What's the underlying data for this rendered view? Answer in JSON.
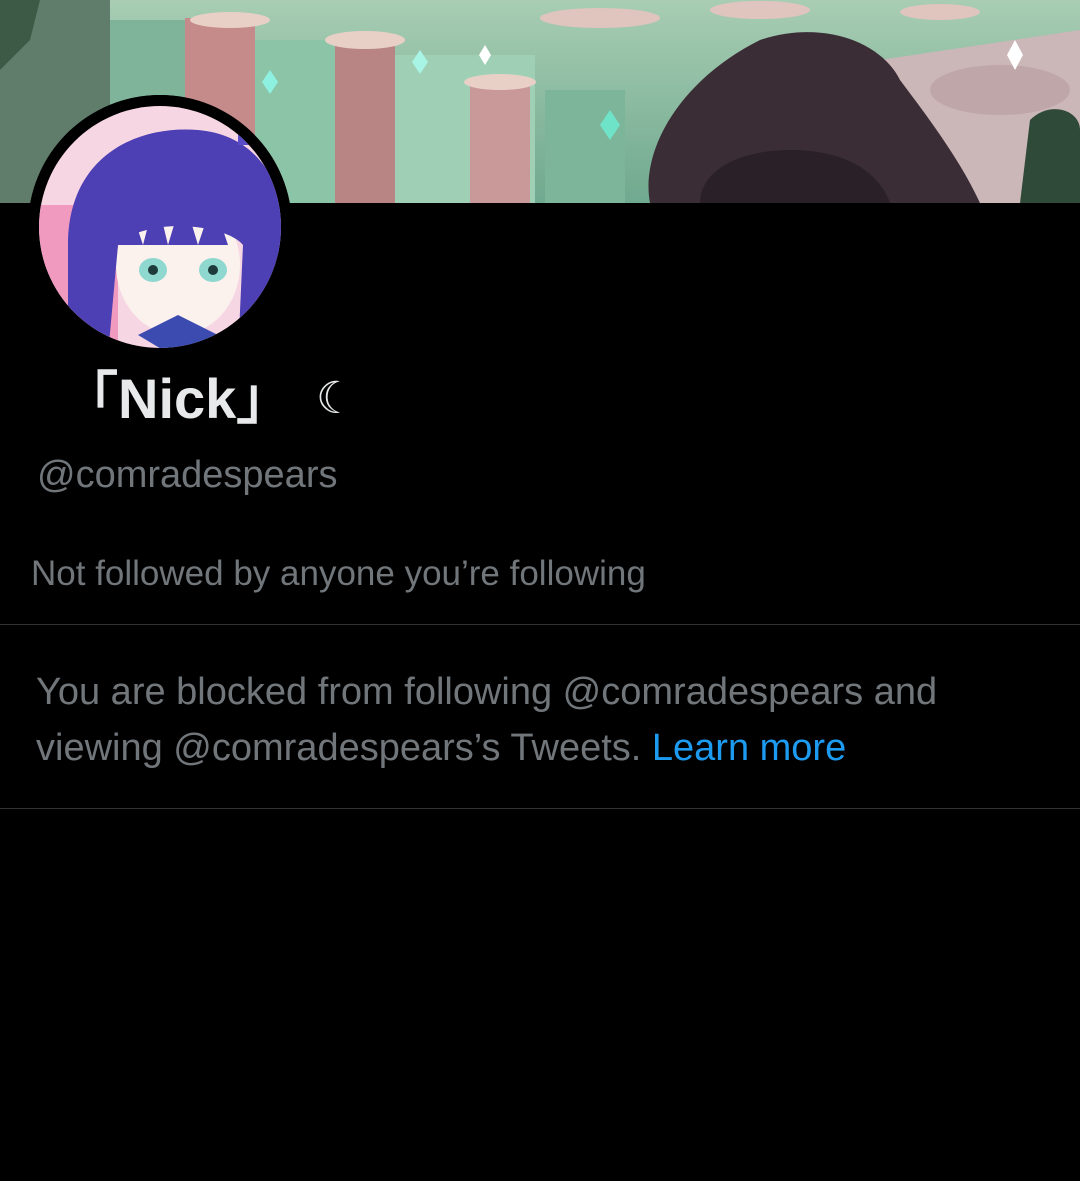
{
  "profile": {
    "display_name": "「Nick」",
    "name_emoji": "☾",
    "handle": "@comradespears",
    "followers_you_know": "Not followed by anyone you’re following"
  },
  "blocked_notice": {
    "line1": "You are blocked from following @comradespears and",
    "line2": "viewing @comradespears’s Tweets.",
    "learn_more": "Learn more"
  },
  "colors": {
    "background": "#000000",
    "primary_text": "#e7e9ea",
    "secondary_text": "#71767b",
    "link": "#1d9bf0",
    "divider": "#2f3336"
  },
  "images": {
    "banner": "cartoon-landscape-banner",
    "avatar": "anime-character-avatar"
  }
}
